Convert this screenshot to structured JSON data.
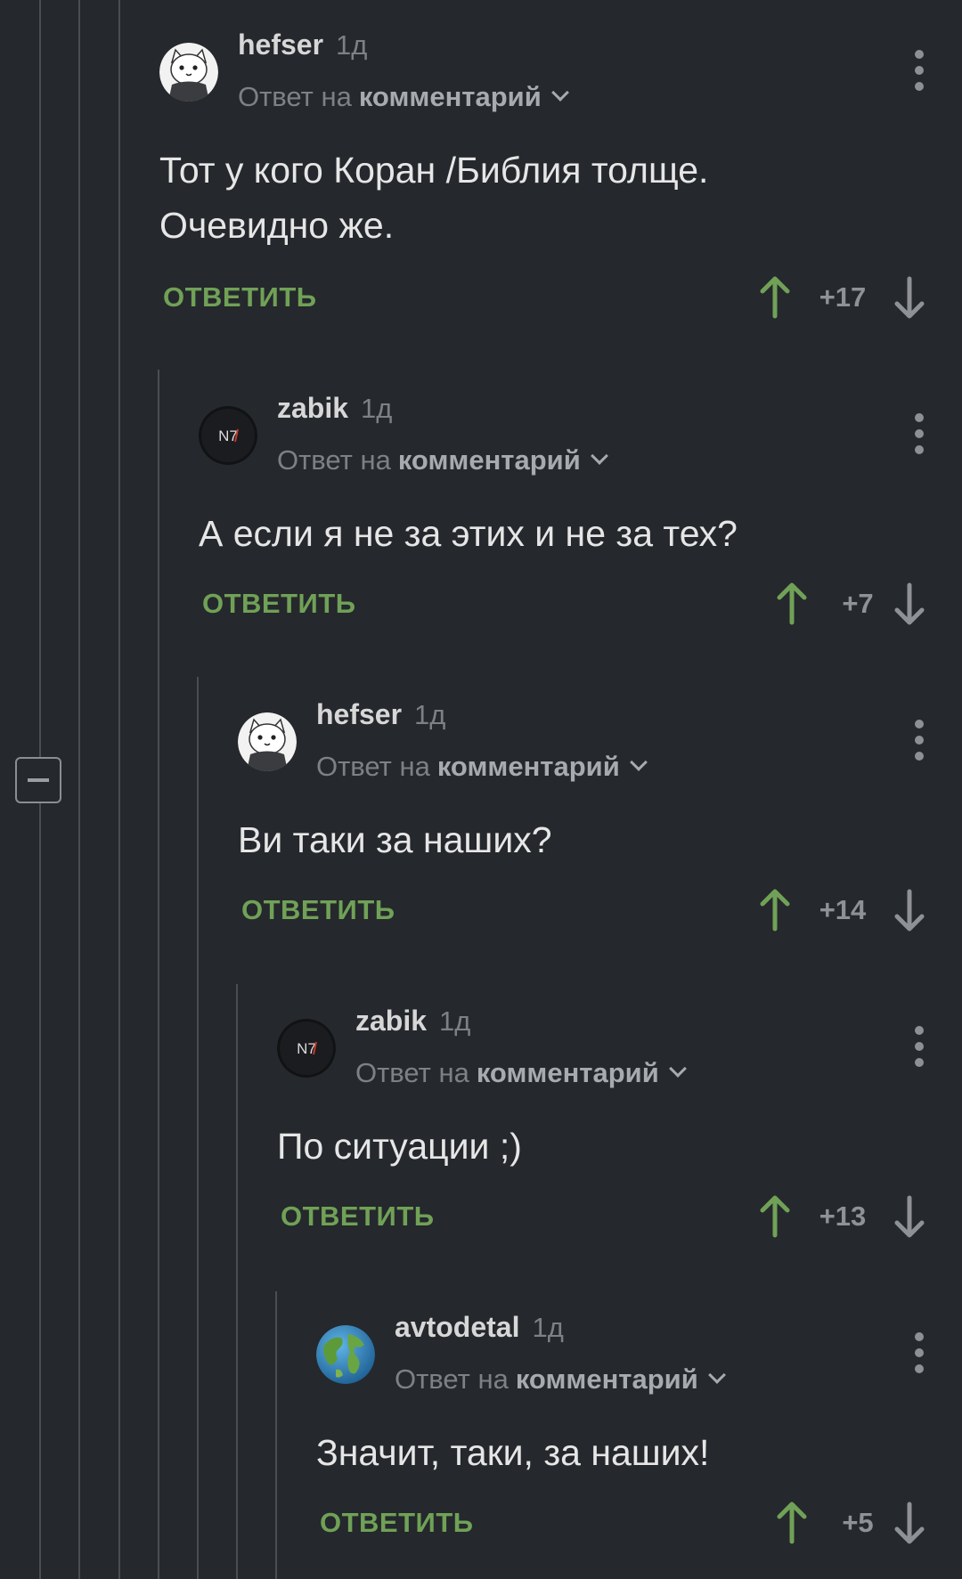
{
  "colors": {
    "background": "#25282c",
    "accent_green": "#70a157",
    "thread_line": "#4a4d52",
    "muted_text": "#7d8085"
  },
  "collapse_button": {
    "icon": "minus-icon"
  },
  "comments": [
    {
      "author": "hefser",
      "time": "1д",
      "reply_prefix": "Ответ на",
      "reply_link": "комментарий",
      "text_lines": [
        "Тот у кого Коран /Библия толще.",
        "Очевидно же."
      ],
      "reply_label": "ОТВЕТИТЬ",
      "score": "+17",
      "avatar": "cat-avatar"
    },
    {
      "author": "zabik",
      "time": "1д",
      "reply_prefix": "Ответ на",
      "reply_link": "комментарий",
      "text_lines": [
        "А если я не за этих и не за тех?"
      ],
      "reply_label": "ОТВЕТИТЬ",
      "score": "+7",
      "avatar": "n7-avatar",
      "avatar_text": "N7"
    },
    {
      "author": "hefser",
      "time": "1д",
      "reply_prefix": "Ответ на",
      "reply_link": "комментарий",
      "text_lines": [
        "Ви таки за наших?"
      ],
      "reply_label": "ОТВЕТИТЬ",
      "score": "+14",
      "avatar": "cat-avatar"
    },
    {
      "author": "zabik",
      "time": "1д",
      "reply_prefix": "Ответ на",
      "reply_link": "комментарий",
      "text_lines": [
        "По ситуации ;)"
      ],
      "reply_label": "ОТВЕТИТЬ",
      "score": "+13",
      "avatar": "n7-avatar",
      "avatar_text": "N7"
    },
    {
      "author": "avtodetal",
      "time": "1д",
      "reply_prefix": "Ответ на",
      "reply_link": "комментарий",
      "text_lines": [
        "Значит, таки, за наших!"
      ],
      "reply_label": "ОТВЕТИТЬ",
      "score": "+5",
      "avatar": "globe-avatar"
    }
  ]
}
